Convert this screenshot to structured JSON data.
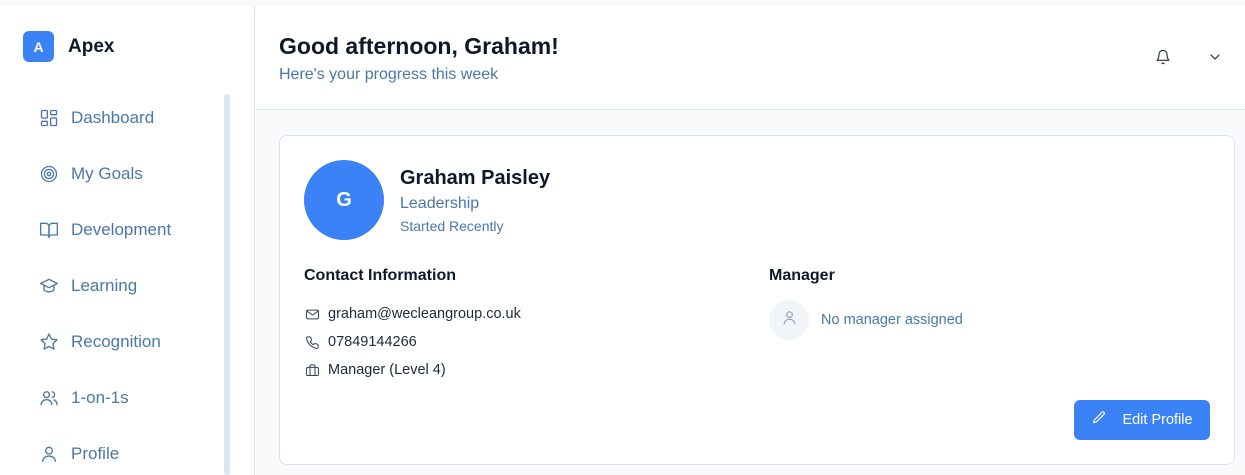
{
  "brand": {
    "badge": "A",
    "name": "Apex"
  },
  "sidebar": {
    "items": [
      {
        "label": "Dashboard",
        "icon": "dashboard-grid-icon"
      },
      {
        "label": "My Goals",
        "icon": "target-icon"
      },
      {
        "label": "Development",
        "icon": "book-open-icon"
      },
      {
        "label": "Learning",
        "icon": "graduation-cap-icon"
      },
      {
        "label": "Recognition",
        "icon": "star-icon"
      },
      {
        "label": "1-on-1s",
        "icon": "users-icon"
      },
      {
        "label": "Profile",
        "icon": "user-icon"
      }
    ]
  },
  "header": {
    "greeting": "Good afternoon, Graham!",
    "subtitle": "Here's your progress this week",
    "icons": [
      "bell-icon",
      "chevron-down-icon"
    ]
  },
  "profile": {
    "initial": "G",
    "name": "Graham Paisley",
    "role": "Leadership",
    "status": "Started Recently",
    "contact": {
      "title": "Contact Information",
      "email": "graham@wecleangroup.co.uk",
      "phone": "07849144266",
      "position": "Manager (Level 4)"
    },
    "manager": {
      "title": "Manager",
      "text": "No manager assigned"
    },
    "edit_label": "Edit Profile"
  },
  "colors": {
    "accent": "#3b82f6",
    "muted_text": "#4a77a8",
    "heading": "#0f172a",
    "border": "#dbe4f0"
  }
}
